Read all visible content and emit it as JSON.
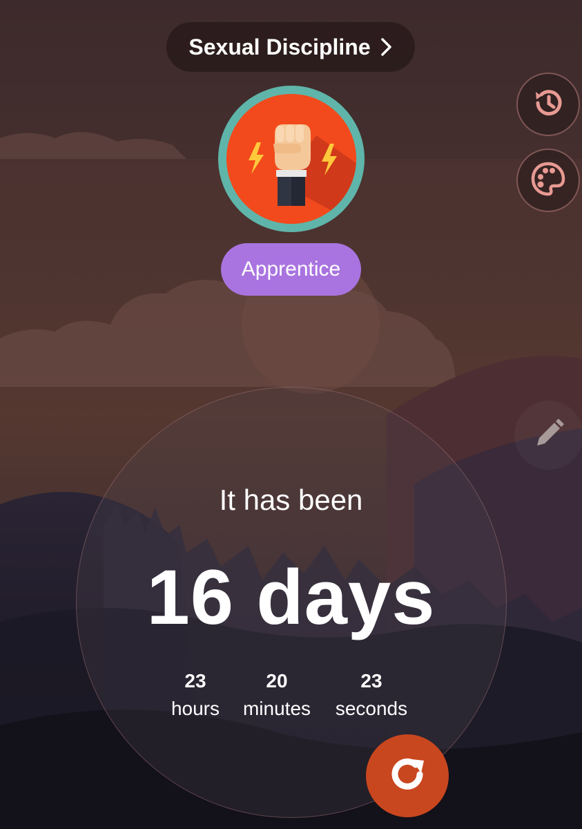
{
  "header": {
    "title": "Sexual Discipline"
  },
  "icons": {
    "header_chevron": "chevron-right-icon",
    "history": "history-icon",
    "theme": "palette-icon",
    "edit": "pencil-icon",
    "avatar": "fist-icon",
    "reset": "reset-icon"
  },
  "badge": {
    "rank": "Apprentice"
  },
  "timer": {
    "intro": "It has been",
    "days": "16 days",
    "hours": {
      "value": "23",
      "label": "hours"
    },
    "minutes": {
      "value": "20",
      "label": "minutes"
    },
    "seconds": {
      "value": "23",
      "label": "seconds"
    }
  },
  "colors": {
    "avatar_ring": "#5fb5a9",
    "avatar_bg": "#f24a1c",
    "badge": "#a974e0",
    "reset_button": "#c9471f",
    "side_icon": "#e89a93"
  }
}
